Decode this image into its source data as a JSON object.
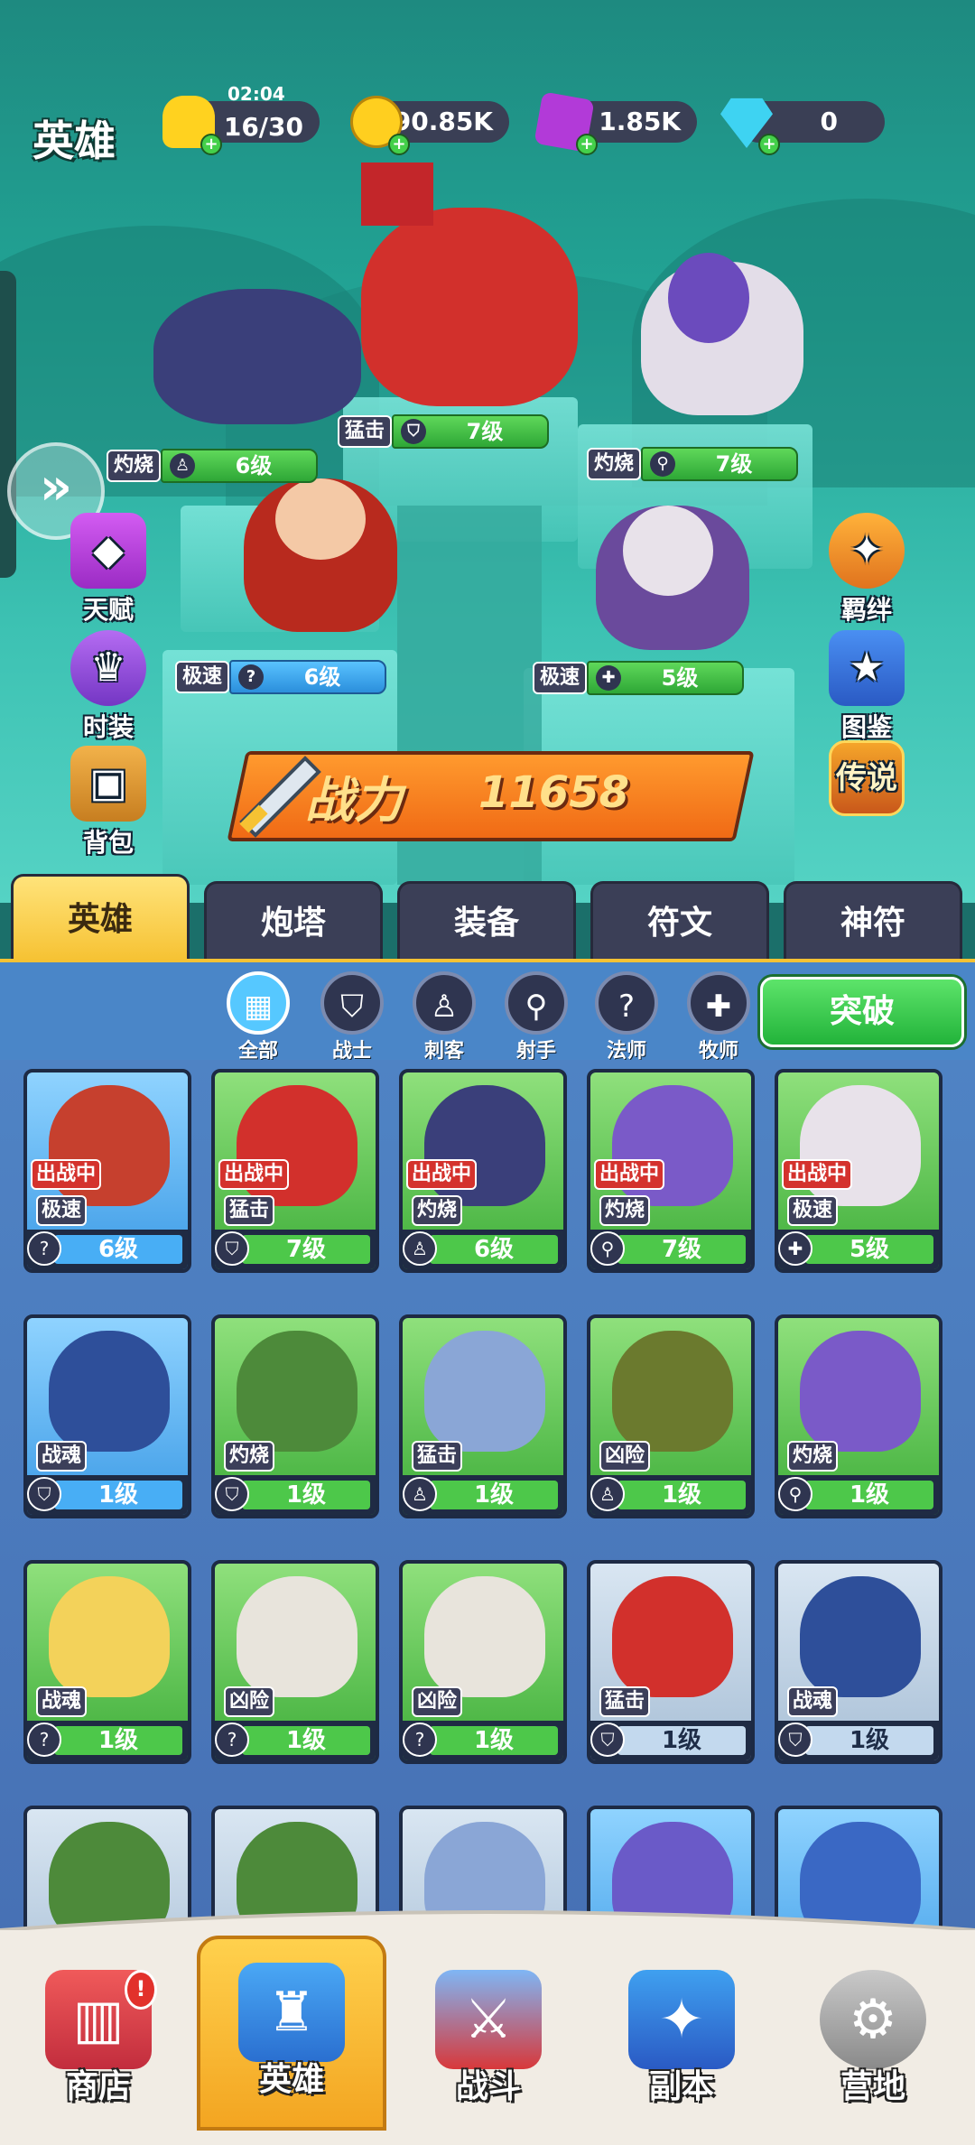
{
  "header": {
    "title": "英雄"
  },
  "resources": [
    {
      "name": "stamina",
      "icon": "lightning-icon",
      "timer": "02:04",
      "value": "16/30",
      "color": "#ffd21f"
    },
    {
      "name": "gold",
      "icon": "coin-icon",
      "value": "90.85K",
      "color": "#ffcf1f"
    },
    {
      "name": "gem",
      "icon": "purple-gem-icon",
      "value": "1.85K",
      "color": "#b23ad8"
    },
    {
      "name": "diamond",
      "icon": "diamond-icon",
      "value": "0",
      "color": "#3ed3f2"
    }
  ],
  "lineup": [
    {
      "skill": "灼烧",
      "class_icon": "assassin-icon",
      "level": "6级",
      "bar": "green"
    },
    {
      "skill": "猛击",
      "class_icon": "warrior-icon",
      "level": "7级",
      "bar": "green"
    },
    {
      "skill": "灼烧",
      "class_icon": "archer-icon",
      "level": "7级",
      "bar": "green"
    },
    {
      "skill": "极速",
      "class_icon": "mage-icon",
      "level": "6级",
      "bar": "blue"
    },
    {
      "skill": "极速",
      "class_icon": "priest-icon",
      "level": "5级",
      "bar": "green"
    }
  ],
  "side_left": [
    {
      "label": "天赋",
      "icon": "talent-icon"
    },
    {
      "label": "时装",
      "icon": "costume-icon"
    },
    {
      "label": "背包",
      "icon": "backpack-icon"
    }
  ],
  "side_right": [
    {
      "label": "羁绊",
      "icon": "bond-icon"
    },
    {
      "label": "图鉴",
      "icon": "codex-icon"
    },
    {
      "label": "传说",
      "icon": "legend-icon"
    }
  ],
  "power": {
    "label": "战力",
    "value": "11658"
  },
  "tabs": [
    "英雄",
    "炮塔",
    "装备",
    "符文",
    "神符"
  ],
  "filters": [
    {
      "label": "全部",
      "icon": "grid-icon"
    },
    {
      "label": "战士",
      "icon": "shield-icon"
    },
    {
      "label": "刺客",
      "icon": "dagger-icon"
    },
    {
      "label": "射手",
      "icon": "bow-icon"
    },
    {
      "label": "法师",
      "icon": "staff-icon"
    },
    {
      "label": "牧师",
      "icon": "cross-icon"
    }
  ],
  "breakthrough_label": "突破",
  "deployed_label": "出战中",
  "cards": [
    {
      "rarity": "blue",
      "deployed": true,
      "skill": "极速",
      "level": "6级",
      "class_icon": "mage-icon",
      "hero": "fire-elf-mage"
    },
    {
      "rarity": "green",
      "deployed": true,
      "skill": "猛击",
      "level": "7级",
      "class_icon": "warrior-icon",
      "hero": "red-ogre"
    },
    {
      "rarity": "green",
      "deployed": true,
      "skill": "灼烧",
      "level": "6级",
      "class_icon": "assassin-icon",
      "hero": "dark-beast"
    },
    {
      "rarity": "green",
      "deployed": true,
      "skill": "灼烧",
      "level": "7级",
      "class_icon": "archer-icon",
      "hero": "tiger-rider"
    },
    {
      "rarity": "green",
      "deployed": true,
      "skill": "极速",
      "level": "5级",
      "class_icon": "priest-icon",
      "hero": "goat-sage"
    },
    {
      "rarity": "blue",
      "deployed": false,
      "skill": "战魂",
      "level": "1级",
      "class_icon": "warrior-icon",
      "hero": "pirate-captain"
    },
    {
      "rarity": "green",
      "deployed": false,
      "skill": "灼烧",
      "level": "1级",
      "class_icon": "warrior-icon",
      "hero": "goblin-scythe"
    },
    {
      "rarity": "green",
      "deployed": false,
      "skill": "猛击",
      "level": "1级",
      "class_icon": "assassin-icon",
      "hero": "blue-troll"
    },
    {
      "rarity": "green",
      "deployed": false,
      "skill": "凶险",
      "level": "1级",
      "class_icon": "assassin-icon",
      "hero": "winged-knight"
    },
    {
      "rarity": "green",
      "deployed": false,
      "skill": "灼烧",
      "level": "1级",
      "class_icon": "archer-icon",
      "hero": "tiger-rider"
    },
    {
      "rarity": "green",
      "deployed": false,
      "skill": "战魂",
      "level": "1级",
      "class_icon": "mage-icon",
      "hero": "blonde-mage"
    },
    {
      "rarity": "green",
      "deployed": false,
      "skill": "凶险",
      "level": "1级",
      "class_icon": "mage-icon",
      "hero": "white-knight"
    },
    {
      "rarity": "green",
      "deployed": false,
      "skill": "凶险",
      "level": "1级",
      "class_icon": "mage-icon",
      "hero": "white-knight"
    },
    {
      "rarity": "gray",
      "deployed": false,
      "skill": "猛击",
      "level": "1级",
      "class_icon": "warrior-icon",
      "hero": "red-ogre"
    },
    {
      "rarity": "gray",
      "deployed": false,
      "skill": "战魂",
      "level": "1级",
      "class_icon": "warrior-icon",
      "hero": "pirate-captain"
    },
    {
      "rarity": "gray",
      "hero": "goblin-scythe"
    },
    {
      "rarity": "gray",
      "hero": "goblin-scythe"
    },
    {
      "rarity": "gray",
      "hero": "blue-troll"
    },
    {
      "rarity": "blue",
      "hero": "violet-elf"
    },
    {
      "rarity": "blue",
      "hero": "old-wizard"
    }
  ],
  "nav": [
    {
      "label": "商店",
      "icon": "shop-icon",
      "badge": "!"
    },
    {
      "label": "英雄",
      "icon": "hero-helmet-icon",
      "active": true
    },
    {
      "label": "战斗",
      "icon": "crossed-swords-icon"
    },
    {
      "label": "副本",
      "icon": "dungeon-icon"
    },
    {
      "label": "营地",
      "icon": "camp-gear-icon"
    }
  ]
}
